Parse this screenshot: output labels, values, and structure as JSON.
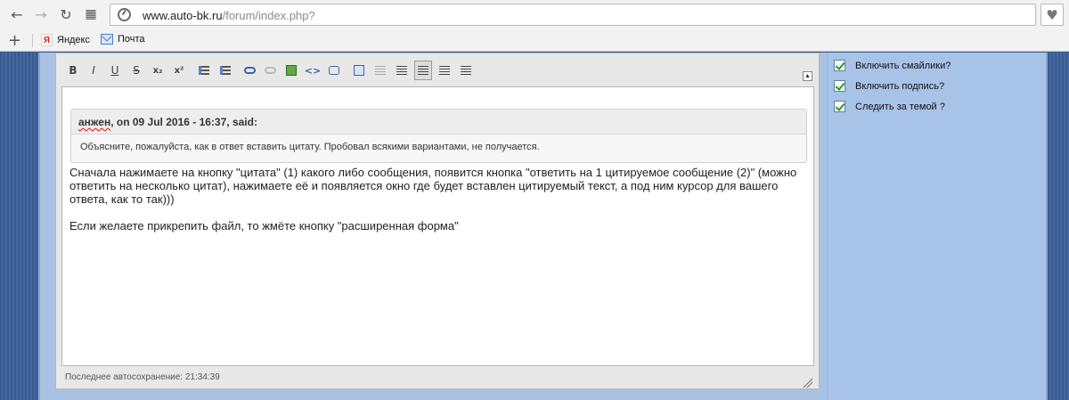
{
  "browser": {
    "url_host": "www.auto-bk.ru",
    "url_path": "/forum/index.php?",
    "bookmarks": [
      {
        "label": "Яндекс",
        "icon": "yandex-icon"
      },
      {
        "label": "Почта",
        "icon": "mail-icon"
      }
    ]
  },
  "editor": {
    "quote": {
      "author": "анжен",
      "meta": ", on 09 Jul 2016 - 16:37, said:",
      "text": "Объясните, пожалуйста, как в ответ вставить цитату. Пробовал всякими вариантами, не получается."
    },
    "reply": [
      "Сначала нажимаете на кнопку \"цитата\" (1) какого либо сообщения, появится кнопка \"ответить на 1 цитируемое сообщение (2)\" (можно ответить на несколько цитат), нажимаете её и появляется окно где будет вставлен цитируемый текст, а под ним курсор для вашего ответа, как то так)))",
      "Если желаете прикрепить файл, то жмёте кнопку \"расширенная форма\""
    ],
    "autosave": "Последнее автосохранение: 21:34:39",
    "toolbar": {
      "bold": "B",
      "italic": "I",
      "underline": "U",
      "strike": "S",
      "subscript": "x₂",
      "superscript": "x²"
    }
  },
  "options": [
    {
      "label": "Включить смайлики?",
      "checked": true
    },
    {
      "label": "Включить подпись?",
      "checked": true
    },
    {
      "label": "Следить за темой ?",
      "checked": true
    }
  ],
  "colors": {
    "accent": "#3b63a6",
    "check": "#1e9a2a",
    "page_bg": "#3d5e94"
  }
}
